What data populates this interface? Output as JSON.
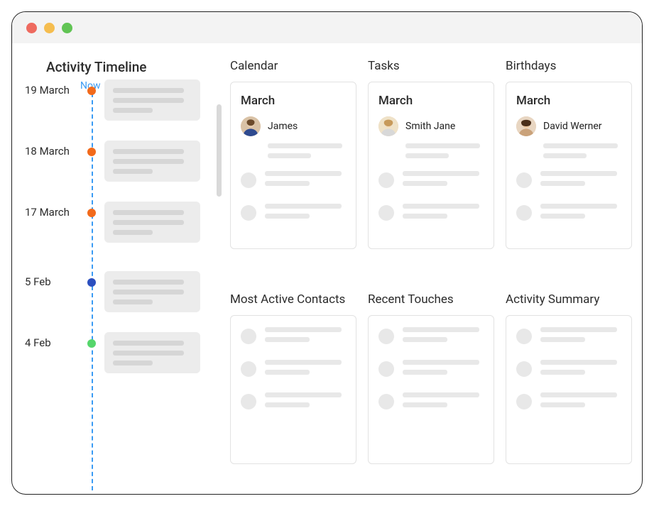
{
  "timeline": {
    "title": "Activity Timeline",
    "now_label": "Now",
    "items": [
      {
        "date": "19 March",
        "dot": "orange"
      },
      {
        "date": "18 March",
        "dot": "orange"
      },
      {
        "date": "17 March",
        "dot": "orange"
      },
      {
        "date": "5 Feb",
        "dot": "blue"
      },
      {
        "date": "4 Feb",
        "dot": "green"
      }
    ]
  },
  "widgets": {
    "calendar": {
      "title": "Calendar",
      "month": "March",
      "person": "James"
    },
    "tasks": {
      "title": "Tasks",
      "month": "March",
      "person": "Smith Jane"
    },
    "birthdays": {
      "title": "Birthdays",
      "month": "March",
      "person": "David Werner"
    },
    "most_active": {
      "title": "Most Active Contacts"
    },
    "recent": {
      "title": "Recent Touches"
    },
    "summary": {
      "title": "Activity Summary"
    }
  }
}
